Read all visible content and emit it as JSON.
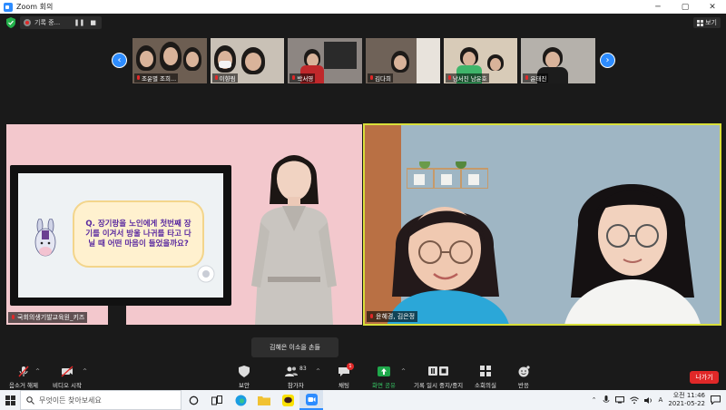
{
  "window": {
    "title": "Zoom 회의",
    "min_glyph": "─",
    "max_glyph": "▢",
    "close_glyph": "✕"
  },
  "topbar": {
    "recording_label": "기록 중...",
    "pause_glyph": "❚❚",
    "stop_glyph": "■",
    "view_label": "보기",
    "view_icon": "grid-icon"
  },
  "thumbnails": [
    {
      "name": "조윤별 조희..."
    },
    {
      "name": "이향림"
    },
    {
      "name": "박서영"
    },
    {
      "name": "김다희"
    },
    {
      "name": "남서진 남윤호"
    },
    {
      "name": "윤태진"
    }
  ],
  "nav": {
    "prev_glyph": "‹",
    "next_glyph": "›"
  },
  "main_videos": {
    "left": {
      "label": "국회의생기발교육원_키즈",
      "slide_text": "Q. 장기랑을 노인에게 첫번째 장기를 이겨서 방울 나귀를 타고 다닐 때 어떤 마음이 들었을까요?"
    },
    "right": {
      "label": "윤혜경, 김은정"
    }
  },
  "tooltip": "김혜은 이소을 손들",
  "toolbar": {
    "unmute": "음소거 해제",
    "video_start": "비디오 시작",
    "security": "보안",
    "participants": "참가자",
    "participants_count": "83",
    "chat": "채팅",
    "chat_badge": "1",
    "share": "화면 공유",
    "record": "기록 일시 중지/중지",
    "breakout": "소회의실",
    "reactions": "반응",
    "leave": "나가기",
    "caret_glyph": "^"
  },
  "taskbar": {
    "search_placeholder": "무엇이든 찾아보세요",
    "time": "오전 11:46",
    "date": "2021-05-22",
    "ime": "A"
  },
  "colors": {
    "accent": "#2d8cff",
    "active_speaker": "#d8df3a",
    "danger": "#e02828",
    "share_green": "#1fa84b"
  }
}
